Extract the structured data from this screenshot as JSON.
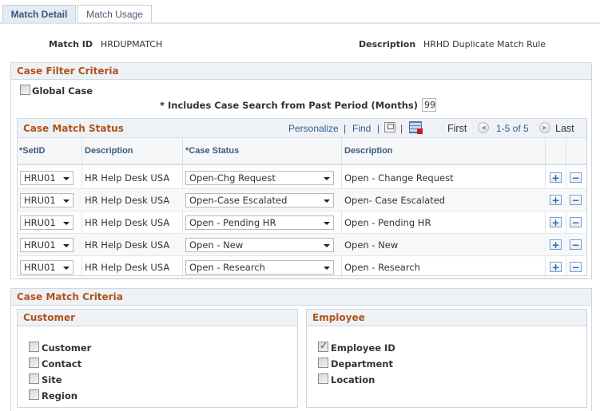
{
  "tabs": [
    {
      "label": "Match Detail",
      "active": true
    },
    {
      "label": "Match Usage",
      "active": false
    }
  ],
  "header": {
    "match_id_label": "Match ID",
    "match_id_value": "HRDUPMATCH",
    "description_label": "Description",
    "description_value": "HRHD Duplicate Match Rule"
  },
  "case_filter": {
    "title": "Case Filter Criteria",
    "global_case_label": "Global Case",
    "global_case_checked": false,
    "past_period_label": "* Includes Case Search from Past Period (Months)",
    "past_period_value": "99"
  },
  "grid": {
    "title": "Case Match Status",
    "personalize": "Personalize",
    "find": "Find",
    "separator": "|",
    "first": "First",
    "range": "1-5 of 5",
    "last": "Last",
    "columns": [
      "*SetID",
      "Description",
      "*Case Status",
      "Description"
    ],
    "rows": [
      {
        "setid": "HRU01",
        "setid_desc": "HR Help Desk USA",
        "status": "Open-Chg Request",
        "status_desc": "Open - Change Request"
      },
      {
        "setid": "HRU01",
        "setid_desc": "HR Help Desk USA",
        "status": "Open-Case Escalated",
        "status_desc": "Open- Case Escalated"
      },
      {
        "setid": "HRU01",
        "setid_desc": "HR Help Desk USA",
        "status": "Open - Pending HR",
        "status_desc": "Open - Pending HR"
      },
      {
        "setid": "HRU01",
        "setid_desc": "HR Help Desk USA",
        "status": "Open - New",
        "status_desc": "Open - New"
      },
      {
        "setid": "HRU01",
        "setid_desc": "HR Help Desk USA",
        "status": "Open - Research",
        "status_desc": "Open - Research"
      }
    ],
    "add_symbol": "+",
    "remove_symbol": "−"
  },
  "match_criteria": {
    "title": "Case Match Criteria",
    "customer": {
      "title": "Customer",
      "items": [
        {
          "label": "Customer",
          "checked": false
        },
        {
          "label": "Contact",
          "checked": false
        },
        {
          "label": "Site",
          "checked": false
        },
        {
          "label": "Region",
          "checked": false
        }
      ]
    },
    "employee": {
      "title": "Employee",
      "items": [
        {
          "label": "Employee ID",
          "checked": true
        },
        {
          "label": "Department",
          "checked": false
        },
        {
          "label": "Location",
          "checked": false
        }
      ]
    }
  },
  "colors": {
    "section_title": "#b0531b",
    "link": "#2c5e92",
    "tab_active_bg": "#e4ebf2"
  }
}
